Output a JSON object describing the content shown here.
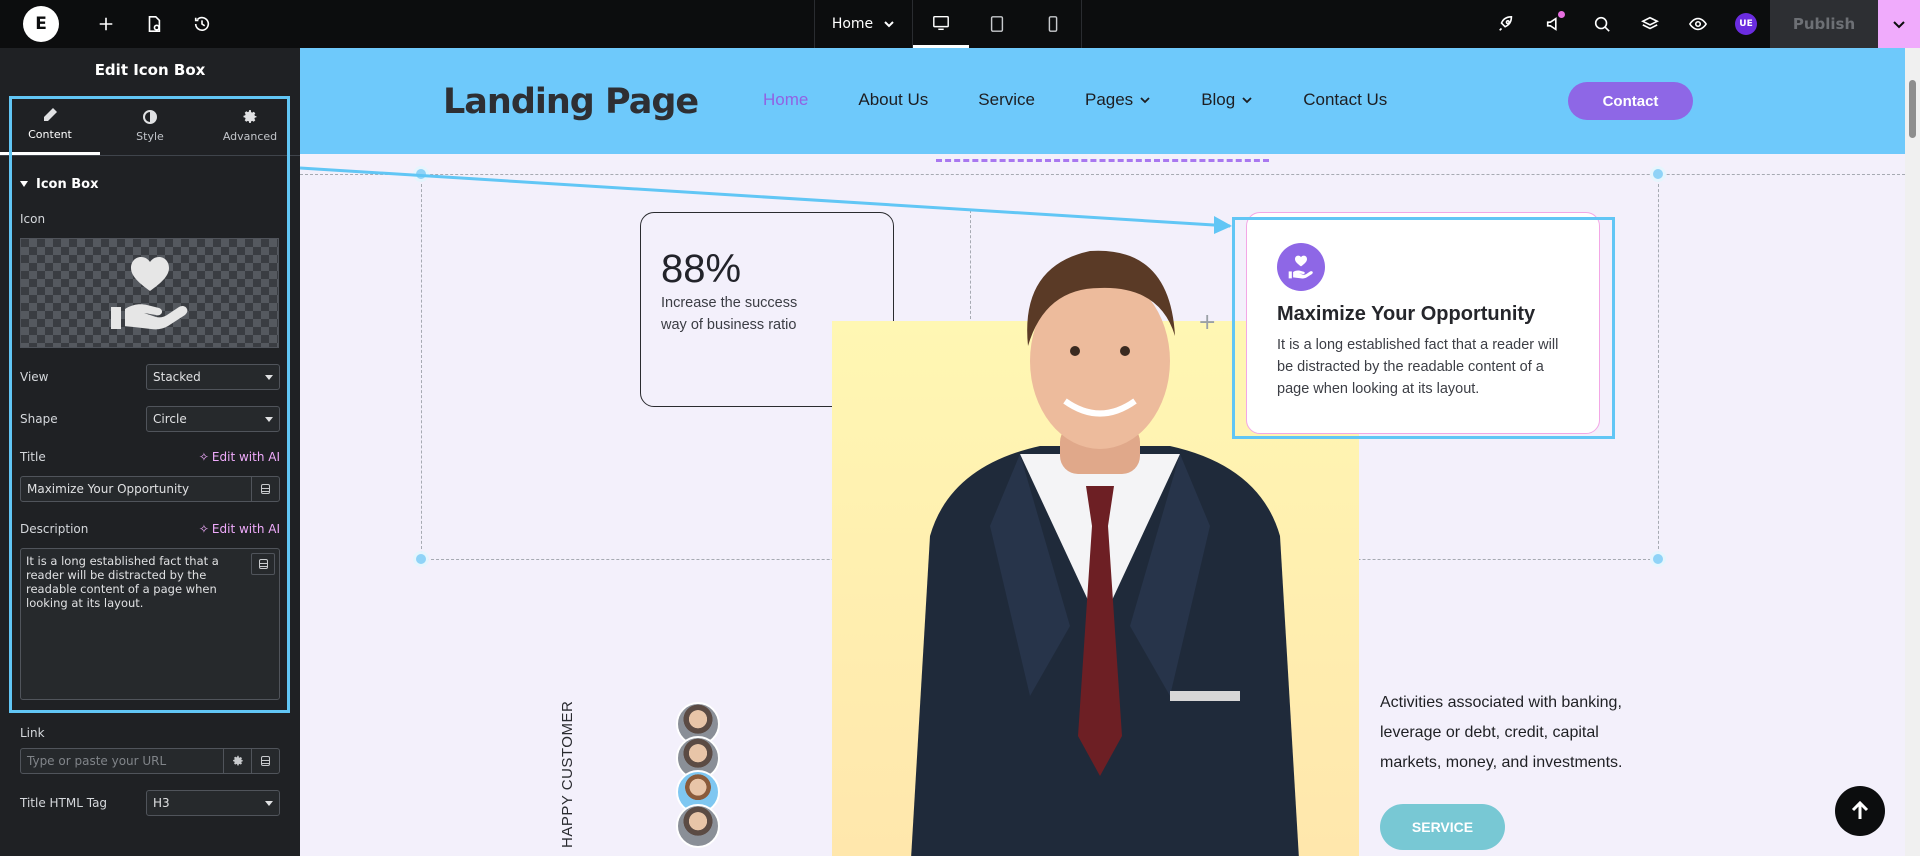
{
  "topbar": {
    "page_name": "Home",
    "user_initials": "UE",
    "publish_label": "Publish",
    "icons": [
      "elementor-logo",
      "plus-icon",
      "page-settings-icon",
      "history-icon",
      "desktop-icon",
      "tablet-icon",
      "mobile-icon",
      "rocket-icon",
      "megaphone-icon",
      "search-icon",
      "layers-icon",
      "eye-icon",
      "chevron-down-icon"
    ]
  },
  "panel": {
    "title": "Edit Icon Box",
    "tabs": [
      {
        "label": "Content",
        "icon": "pencil-icon",
        "active": true
      },
      {
        "label": "Style",
        "icon": "half-circle-icon",
        "active": false
      },
      {
        "label": "Advanced",
        "icon": "gear-icon",
        "active": false
      }
    ],
    "section": "Icon Box",
    "icon_label": "Icon",
    "view_label": "View",
    "view_value": "Stacked",
    "shape_label": "Shape",
    "shape_value": "Circle",
    "title_label": "Title",
    "edit_ai": "Edit with AI",
    "title_value": "Maximize Your  Opportunity",
    "description_label": "Description",
    "description_value": "It is a long established fact that a reader will be distracted by the readable content of a page when looking at its layout.",
    "link_label": "Link",
    "link_placeholder": "Type or paste your URL",
    "html_tag_label": "Title HTML Tag",
    "html_tag_value": "H3"
  },
  "site": {
    "brand": "Landing Page",
    "nav": [
      {
        "label": "Home",
        "current": true,
        "dropdown": false
      },
      {
        "label": "About Us",
        "current": false,
        "dropdown": false
      },
      {
        "label": "Service",
        "current": false,
        "dropdown": false
      },
      {
        "label": "Pages",
        "current": false,
        "dropdown": true
      },
      {
        "label": "Blog",
        "current": false,
        "dropdown": true
      },
      {
        "label": "Contact Us",
        "current": false,
        "dropdown": false
      }
    ],
    "contact_button": "Contact",
    "stat_number": "88%",
    "stat_text": "Increase the success way of business ratio",
    "feature_title": "Maximize Your Opportunity",
    "feature_desc": "It is a long established fact that a reader will be distracted by the readable content of a page when looking at its layout.",
    "happy_customer": "HAPPY CUSTOMER",
    "activities": "Activities associated with banking, leverage or debt, credit, capital markets, money, and investments.",
    "service_button": "SERVICE"
  },
  "colors": {
    "header_bg": "#6ec9fb",
    "accent_purple": "#8e67e6",
    "selection_blue": "#61c6f5",
    "ai_pink": "#f0abfc",
    "service_teal": "#78c8d4"
  }
}
